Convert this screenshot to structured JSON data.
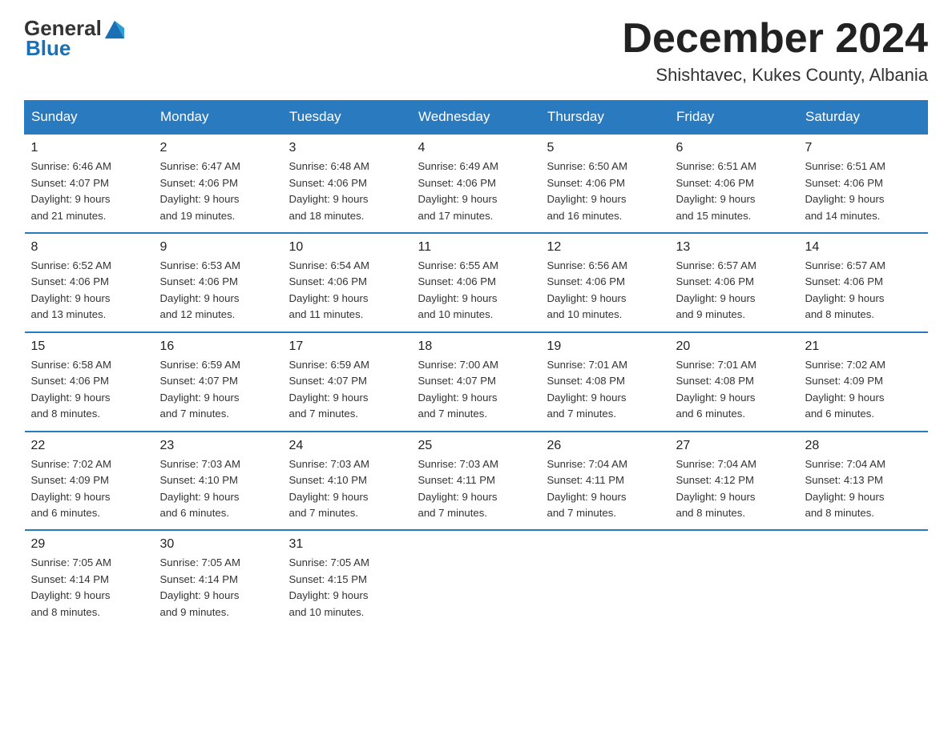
{
  "header": {
    "logo_general": "General",
    "logo_blue": "Blue",
    "month_title": "December 2024",
    "location": "Shishtavec, Kukes County, Albania"
  },
  "days_of_week": [
    "Sunday",
    "Monday",
    "Tuesday",
    "Wednesday",
    "Thursday",
    "Friday",
    "Saturday"
  ],
  "weeks": [
    [
      {
        "day": "1",
        "sunrise": "6:46 AM",
        "sunset": "4:07 PM",
        "daylight": "9 hours and 21 minutes."
      },
      {
        "day": "2",
        "sunrise": "6:47 AM",
        "sunset": "4:06 PM",
        "daylight": "9 hours and 19 minutes."
      },
      {
        "day": "3",
        "sunrise": "6:48 AM",
        "sunset": "4:06 PM",
        "daylight": "9 hours and 18 minutes."
      },
      {
        "day": "4",
        "sunrise": "6:49 AM",
        "sunset": "4:06 PM",
        "daylight": "9 hours and 17 minutes."
      },
      {
        "day": "5",
        "sunrise": "6:50 AM",
        "sunset": "4:06 PM",
        "daylight": "9 hours and 16 minutes."
      },
      {
        "day": "6",
        "sunrise": "6:51 AM",
        "sunset": "4:06 PM",
        "daylight": "9 hours and 15 minutes."
      },
      {
        "day": "7",
        "sunrise": "6:51 AM",
        "sunset": "4:06 PM",
        "daylight": "9 hours and 14 minutes."
      }
    ],
    [
      {
        "day": "8",
        "sunrise": "6:52 AM",
        "sunset": "4:06 PM",
        "daylight": "9 hours and 13 minutes."
      },
      {
        "day": "9",
        "sunrise": "6:53 AM",
        "sunset": "4:06 PM",
        "daylight": "9 hours and 12 minutes."
      },
      {
        "day": "10",
        "sunrise": "6:54 AM",
        "sunset": "4:06 PM",
        "daylight": "9 hours and 11 minutes."
      },
      {
        "day": "11",
        "sunrise": "6:55 AM",
        "sunset": "4:06 PM",
        "daylight": "9 hours and 10 minutes."
      },
      {
        "day": "12",
        "sunrise": "6:56 AM",
        "sunset": "4:06 PM",
        "daylight": "9 hours and 10 minutes."
      },
      {
        "day": "13",
        "sunrise": "6:57 AM",
        "sunset": "4:06 PM",
        "daylight": "9 hours and 9 minutes."
      },
      {
        "day": "14",
        "sunrise": "6:57 AM",
        "sunset": "4:06 PM",
        "daylight": "9 hours and 8 minutes."
      }
    ],
    [
      {
        "day": "15",
        "sunrise": "6:58 AM",
        "sunset": "4:06 PM",
        "daylight": "9 hours and 8 minutes."
      },
      {
        "day": "16",
        "sunrise": "6:59 AM",
        "sunset": "4:07 PM",
        "daylight": "9 hours and 7 minutes."
      },
      {
        "day": "17",
        "sunrise": "6:59 AM",
        "sunset": "4:07 PM",
        "daylight": "9 hours and 7 minutes."
      },
      {
        "day": "18",
        "sunrise": "7:00 AM",
        "sunset": "4:07 PM",
        "daylight": "9 hours and 7 minutes."
      },
      {
        "day": "19",
        "sunrise": "7:01 AM",
        "sunset": "4:08 PM",
        "daylight": "9 hours and 7 minutes."
      },
      {
        "day": "20",
        "sunrise": "7:01 AM",
        "sunset": "4:08 PM",
        "daylight": "9 hours and 6 minutes."
      },
      {
        "day": "21",
        "sunrise": "7:02 AM",
        "sunset": "4:09 PM",
        "daylight": "9 hours and 6 minutes."
      }
    ],
    [
      {
        "day": "22",
        "sunrise": "7:02 AM",
        "sunset": "4:09 PM",
        "daylight": "9 hours and 6 minutes."
      },
      {
        "day": "23",
        "sunrise": "7:03 AM",
        "sunset": "4:10 PM",
        "daylight": "9 hours and 6 minutes."
      },
      {
        "day": "24",
        "sunrise": "7:03 AM",
        "sunset": "4:10 PM",
        "daylight": "9 hours and 7 minutes."
      },
      {
        "day": "25",
        "sunrise": "7:03 AM",
        "sunset": "4:11 PM",
        "daylight": "9 hours and 7 minutes."
      },
      {
        "day": "26",
        "sunrise": "7:04 AM",
        "sunset": "4:11 PM",
        "daylight": "9 hours and 7 minutes."
      },
      {
        "day": "27",
        "sunrise": "7:04 AM",
        "sunset": "4:12 PM",
        "daylight": "9 hours and 8 minutes."
      },
      {
        "day": "28",
        "sunrise": "7:04 AM",
        "sunset": "4:13 PM",
        "daylight": "9 hours and 8 minutes."
      }
    ],
    [
      {
        "day": "29",
        "sunrise": "7:05 AM",
        "sunset": "4:14 PM",
        "daylight": "9 hours and 8 minutes."
      },
      {
        "day": "30",
        "sunrise": "7:05 AM",
        "sunset": "4:14 PM",
        "daylight": "9 hours and 9 minutes."
      },
      {
        "day": "31",
        "sunrise": "7:05 AM",
        "sunset": "4:15 PM",
        "daylight": "9 hours and 10 minutes."
      },
      null,
      null,
      null,
      null
    ]
  ],
  "labels": {
    "sunrise": "Sunrise:",
    "sunset": "Sunset:",
    "daylight": "Daylight:"
  }
}
